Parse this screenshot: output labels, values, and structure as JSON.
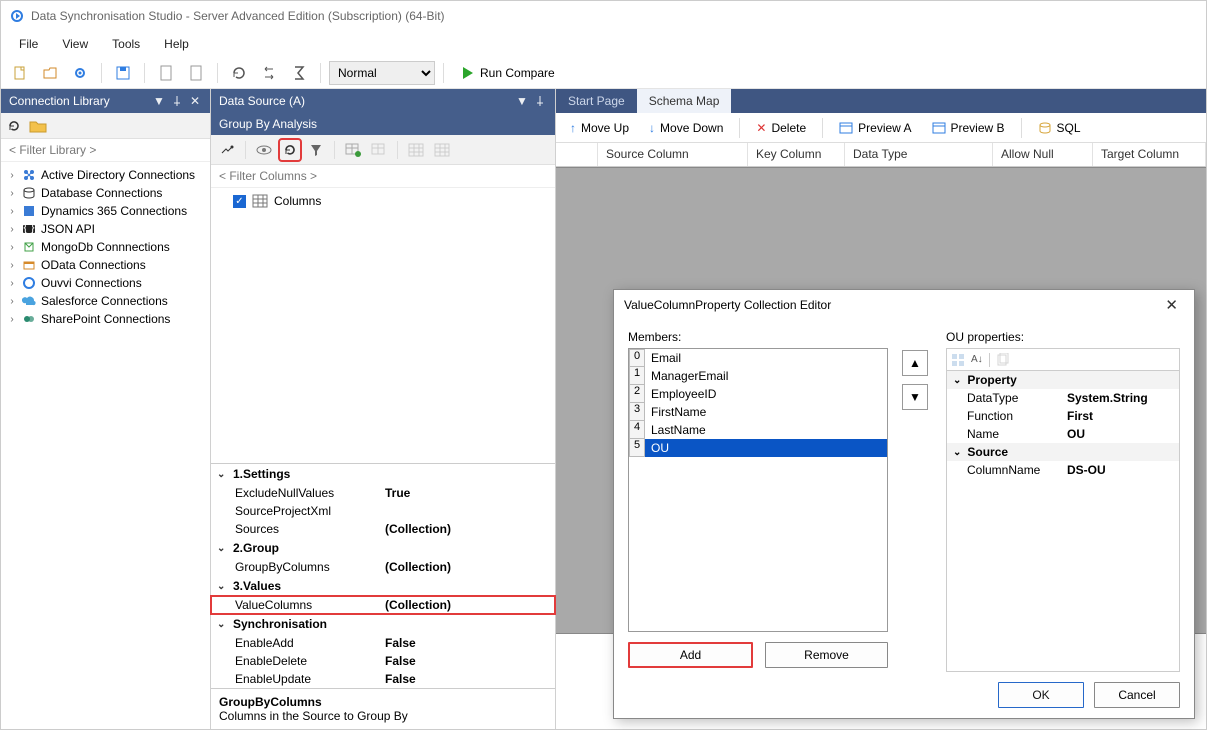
{
  "window": {
    "title": "Data Synchronisation Studio - Server Advanced Edition (Subscription) (64-Bit)"
  },
  "menu": {
    "file": "File",
    "view": "View",
    "tools": "Tools",
    "help": "Help"
  },
  "toolbar": {
    "mode": "Normal",
    "runcompare": "Run Compare"
  },
  "connlib": {
    "title": "Connection Library",
    "filter": "< Filter Library >",
    "items": [
      "Active Directory Connections",
      "Database Connections",
      "Dynamics 365 Connections",
      "JSON API",
      "MongoDb Connnections",
      "OData Connections",
      "Ouvvi Connections",
      "Salesforce Connections",
      "SharePoint Connections"
    ]
  },
  "dsa": {
    "title": "Data Source (A)",
    "group": "Group By Analysis",
    "filter": "< Filter Columns >",
    "columns_label": "Columns",
    "propgrid": {
      "sections": {
        "settings": "1.Settings",
        "group": "2.Group",
        "values": "3.Values",
        "sync": "Synchronisation"
      },
      "rows": {
        "excludeNull": {
          "name": "ExcludeNullValues",
          "val": "True"
        },
        "sourceXml": {
          "name": "SourceProjectXml",
          "val": ""
        },
        "sources": {
          "name": "Sources",
          "val": "(Collection)"
        },
        "groupBy": {
          "name": "GroupByColumns",
          "val": "(Collection)"
        },
        "valueCols": {
          "name": "ValueColumns",
          "val": "(Collection)"
        },
        "enableAdd": {
          "name": "EnableAdd",
          "val": "False"
        },
        "enableDelete": {
          "name": "EnableDelete",
          "val": "False"
        },
        "enableUpdate": {
          "name": "EnableUpdate",
          "val": "False"
        }
      },
      "desc": {
        "title": "GroupByColumns",
        "text": "Columns in the Source to Group By"
      }
    }
  },
  "schema": {
    "tabs": {
      "start": "Start Page",
      "map": "Schema Map"
    },
    "tools": {
      "moveup": "Move Up",
      "movedown": "Move Down",
      "delete": "Delete",
      "previewA": "Preview A",
      "previewB": "Preview B",
      "sql": "SQL"
    },
    "headers": {
      "source": "Source Column",
      "key": "Key Column",
      "datatype": "Data Type",
      "allownull": "Allow Null",
      "target": "Target Column"
    }
  },
  "dialog": {
    "title": "ValueColumnProperty Collection Editor",
    "members_label": "Members:",
    "members": [
      "Email",
      "ManagerEmail",
      "EmployeeID",
      "FirstName",
      "LastName",
      "OU"
    ],
    "selected_index": 5,
    "add": "Add",
    "remove": "Remove",
    "props_label": "OU properties:",
    "prop_sections": {
      "property": "Property",
      "source": "Source"
    },
    "props": {
      "datatype": {
        "name": "DataType",
        "val": "System.String"
      },
      "function": {
        "name": "Function",
        "val": "First"
      },
      "name": {
        "name": "Name",
        "val": "OU"
      },
      "colname": {
        "name": "ColumnName",
        "val": "DS-OU"
      }
    },
    "ok": "OK",
    "cancel": "Cancel"
  }
}
